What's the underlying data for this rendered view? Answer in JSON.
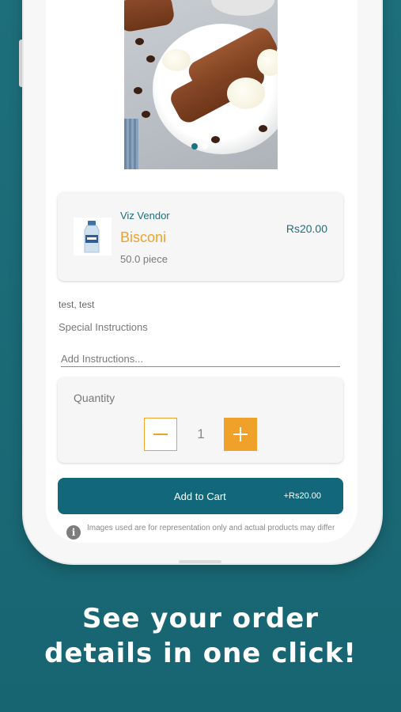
{
  "product": {
    "vendor": "Viz Vendor",
    "name": "Bisconi",
    "quantity_unit": "50.0 piece",
    "price": "Rs20.00",
    "image_description_icon": "biscotti-photo",
    "thumbnail_icon": "water-bottle-icon"
  },
  "carousel": {
    "total": 2,
    "active": 1
  },
  "address_note": "test, test",
  "instructions": {
    "label": "Special Instructions",
    "placeholder": "Add Instructions..."
  },
  "quantity": {
    "label": "Quantity",
    "value": "1",
    "minus_icon": "minus-icon",
    "plus_icon": "plus-icon"
  },
  "cart": {
    "label": "Add to Cart",
    "price": "+Rs20.00"
  },
  "disclaimer": {
    "icon": "info-icon",
    "text": "Images used are for representation only and actual products may differ"
  },
  "headline": {
    "line1": "See your order",
    "line2": "details in one click!"
  },
  "colors": {
    "background": "#1b6a76",
    "accent": "#efa12a",
    "primary": "#12687a",
    "card": "#f6f6f6"
  }
}
